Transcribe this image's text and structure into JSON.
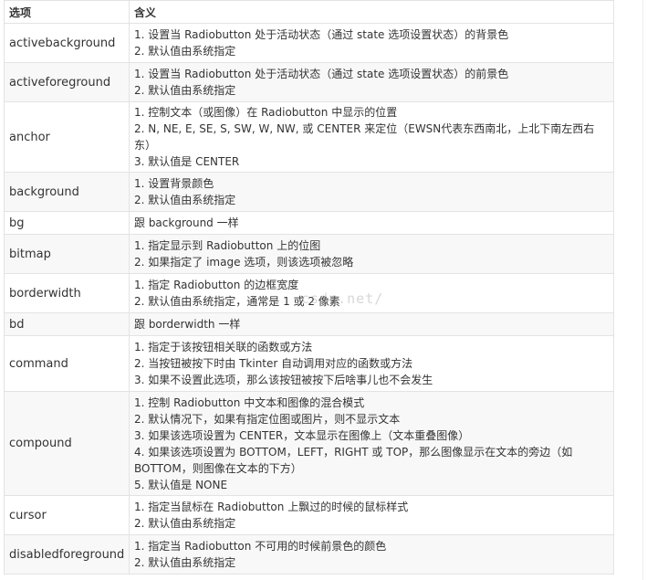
{
  "table": {
    "headers": [
      "选项",
      "含义"
    ],
    "rows": [
      {
        "option": "activebackground",
        "desc": [
          "1. 设置当 Radiobutton 处于活动状态（通过 state 选项设置状态）的背景色",
          "2. 默认值由系统指定"
        ]
      },
      {
        "option": "activeforeground",
        "desc": [
          "1. 设置当 Radiobutton 处于活动状态（通过 state 选项设置状态）的前景色",
          "2. 默认值由系统指定"
        ]
      },
      {
        "option": "anchor",
        "desc": [
          "1. 控制文本（或图像）在 Radiobutton 中显示的位置",
          "2. N, NE, E, SE, S, SW, W, NW, 或 CENTER 来定位（EWSN代表东西南北，上北下南左西右东）",
          "3. 默认值是 CENTER"
        ]
      },
      {
        "option": "background",
        "desc": [
          "1. 设置背景颜色",
          "2. 默认值由系统指定"
        ]
      },
      {
        "option": "bg",
        "desc": [
          "跟 background 一样"
        ]
      },
      {
        "option": "bitmap",
        "desc": [
          "1. 指定显示到 Radiobutton 上的位图",
          "2. 如果指定了 image 选项，则该选项被忽略"
        ]
      },
      {
        "option": "borderwidth",
        "desc": [
          "1. 指定 Radiobutton 的边框宽度",
          "2. 默认值由系统指定，通常是 1 或 2 像素"
        ]
      },
      {
        "option": "bd",
        "desc": [
          "跟 borderwidth 一样"
        ]
      },
      {
        "option": "command",
        "desc": [
          "1. 指定于该按钮相关联的函数或方法",
          "2. 当按钮被按下时由 Tkinter 自动调用对应的函数或方法",
          "3. 如果不设置此选项，那么该按钮被按下后啥事儿也不会发生"
        ]
      },
      {
        "option": "compound",
        "desc": [
          "1. 控制 Radiobutton 中文本和图像的混合模式",
          "2. 默认情况下，如果有指定位图或图片，则不显示文本",
          "3. 如果该选项设置为 CENTER，文本显示在图像上（文本重叠图像）",
          "4. 如果该选项设置为 BOTTOM，LEFT，RIGHT 或 TOP，那么图像显示在文本的旁边（如 BOTTOM，则图像在文本的下方）",
          "5. 默认值是 NONE"
        ]
      },
      {
        "option": "cursor",
        "desc": [
          "1. 指定当鼠标在 Radiobutton 上飘过的时候的鼠标样式",
          "2. 默认值由系统指定"
        ]
      },
      {
        "option": "disabledforeground",
        "desc": [
          "1. 指定当 Radiobutton 不可用的时候前景色的颜色",
          "2. 默认值由系统指定"
        ]
      }
    ]
  },
  "watermark": "csdn.net/"
}
